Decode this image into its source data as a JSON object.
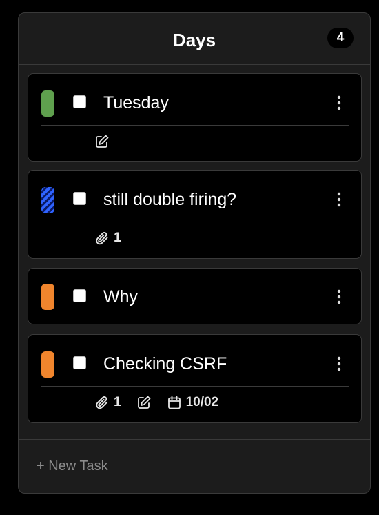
{
  "column": {
    "title": "Days",
    "count": "4",
    "new_task_label": "+ New Task"
  },
  "cards": [
    {
      "title": "Tuesday",
      "tag_color": "#5fa04e",
      "meta": {
        "edit": true
      }
    },
    {
      "title": "still double firing?",
      "tag_color": "striped-blue",
      "meta": {
        "attachments": "1"
      }
    },
    {
      "title": "Why",
      "tag_color": "#f0852d"
    },
    {
      "title": "Checking CSRF",
      "tag_color": "#f0852d",
      "meta": {
        "attachments": "1",
        "edit": true,
        "due_date": "10/02"
      }
    }
  ],
  "icons": {
    "menu": "more-vertical-icon",
    "attachment": "paperclip-icon",
    "edit": "edit-note-icon",
    "calendar": "calendar-icon"
  }
}
